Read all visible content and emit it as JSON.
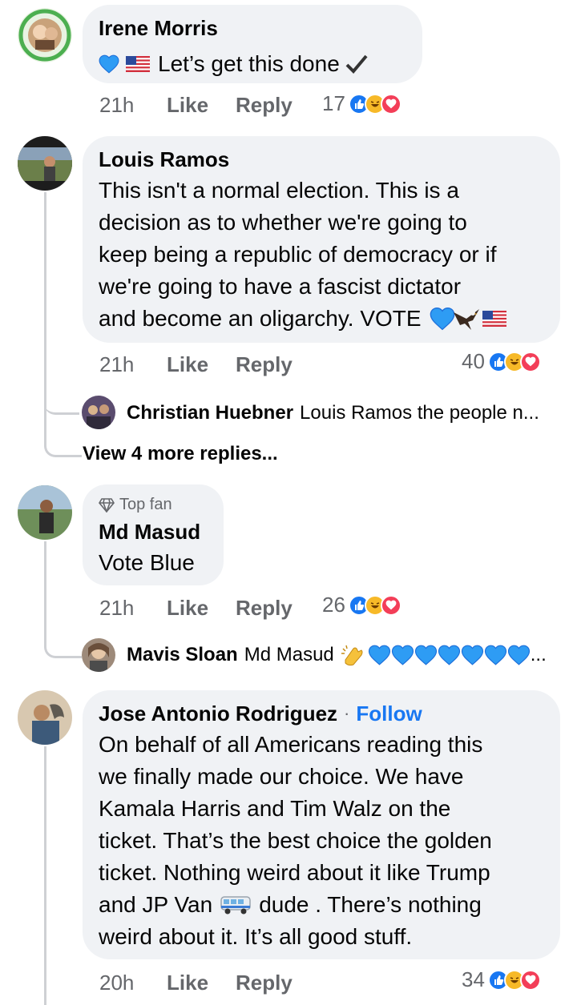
{
  "colors": {
    "like_blue": "#1877f2",
    "haha_yellow": "#f7b928",
    "love_red": "#f33e58",
    "bubble": "#f0f2f5",
    "meta_gray": "#65676b"
  },
  "comments": [
    {
      "author": "Irene Morris",
      "text": "Let’s get this done",
      "emoji_prefix": [
        "blue-heart-icon",
        "us-flag-icon"
      ],
      "emoji_suffix": [
        "checkmark-icon"
      ],
      "time": "21h",
      "like": "Like",
      "reply": "Reply",
      "reactions_count": "17",
      "reaction_icons": [
        "like-icon",
        "haha-icon",
        "love-icon"
      ]
    },
    {
      "author": "Louis Ramos",
      "lines": [
        "This isn't a normal election. This is a",
        "decision as to whether we're going to",
        "keep being a republic of democracy or if",
        "we're going to have a fascist dictator",
        "and become an oligarchy. VOTE"
      ],
      "emoji_suffix": [
        "blue-heart-icon",
        "eagle-icon",
        "us-flag-icon"
      ],
      "time": "21h",
      "like": "Like",
      "reply": "Reply",
      "reactions_count": "40",
      "reaction_icons": [
        "like-icon",
        "haha-icon",
        "love-icon"
      ],
      "reply_preview": {
        "author": "Christian Huebner",
        "text": "Louis Ramos the people n..."
      },
      "view_more": "View 4 more replies..."
    },
    {
      "badge": "Top fan",
      "author": "Md Masud",
      "text": "Vote Blue",
      "time": "21h",
      "like": "Like",
      "reply": "Reply",
      "reactions_count": "26",
      "reaction_icons": [
        "like-icon",
        "haha-icon",
        "love-icon"
      ],
      "reply_preview": {
        "author": "Mavis Sloan",
        "text": "Md Masud",
        "trailing": "..."
      }
    },
    {
      "author": "Jose Antonio Rodriguez",
      "separator": "·",
      "follow": "Follow",
      "lines": [
        "On behalf of all Americans reading this",
        "we finally made our choice. We have",
        "Kamala Harris and Tim Walz on the",
        "ticket. That’s the best choice the golden",
        "ticket. Nothing weird about it like Trump"
      ],
      "line6_a": "and JP Van",
      "line6_b": "dude . There’s nothing",
      "line7": "weird about it. It’s all good stuff.",
      "time": "20h",
      "like": "Like",
      "reply": "Reply",
      "reactions_count": "34",
      "reaction_icons": [
        "like-icon",
        "haha-icon",
        "love-icon"
      ]
    }
  ]
}
